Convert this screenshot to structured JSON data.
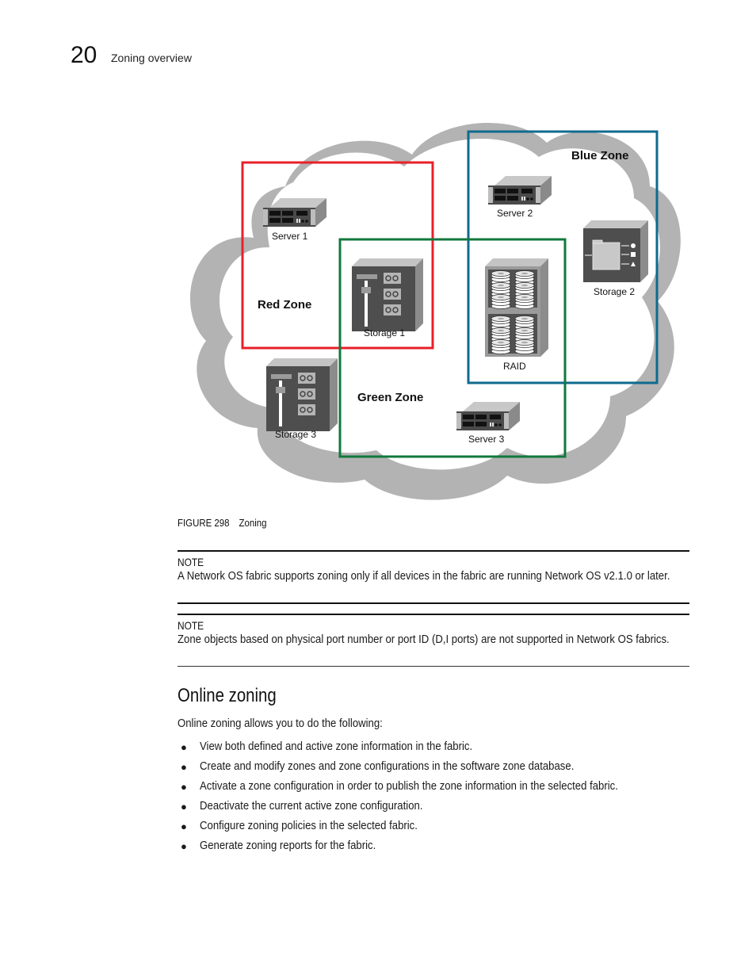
{
  "header": {
    "chapter_number": "20",
    "chapter_title": "Zoning overview"
  },
  "figure": {
    "label": "FIGURE 298",
    "title": "Zoning",
    "zones": [
      {
        "name": "Red Zone",
        "color": "#e8202a",
        "members": [
          "Server 1",
          "Storage 1"
        ]
      },
      {
        "name": "Blue Zone",
        "color": "#0f6a8e",
        "members": [
          "Server 2",
          "Storage 2",
          "RAID"
        ]
      },
      {
        "name": "Green Zone",
        "color": "#12783e",
        "members": [
          "Storage 1",
          "RAID",
          "Server 3"
        ]
      }
    ],
    "devices": {
      "server1": "Server 1",
      "server2": "Server 2",
      "server3": "Server 3",
      "storage1": "Storage 1",
      "storage2": "Storage 2",
      "storage3": "Storage 3",
      "raid": "RAID"
    },
    "cloud_color": "#b3b3b3"
  },
  "notes": [
    {
      "heading": "NOTE",
      "body": "A Network OS fabric supports zoning only if all devices in the fabric are running Network OS v2.1.0 or later."
    },
    {
      "heading": "NOTE",
      "body": "Zone objects based on physical port number or port ID (D,I ports) are not supported in Network OS fabrics."
    }
  ],
  "section": {
    "title": "Online zoning",
    "intro": "Online zoning allows you to do the following:",
    "bullets": [
      "View both defined and active zone information in the fabric.",
      "Create and modify zones and zone configurations in the software zone database.",
      "Activate a zone configuration in order to publish the zone information in the selected fabric.",
      "Deactivate the current active zone configuration.",
      "Configure zoning policies in the selected fabric.",
      "Generate zoning reports for the fabric."
    ]
  }
}
